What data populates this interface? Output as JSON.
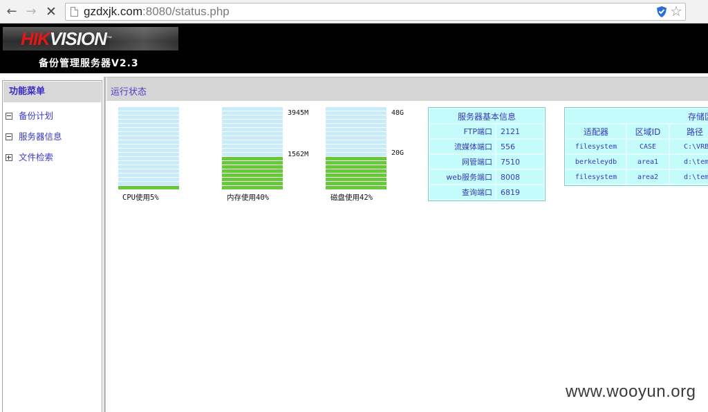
{
  "browser": {
    "url_host": "gzdxjk.com",
    "url_rest": ":8080/status.php",
    "back_icon": "←",
    "forward_icon": "→",
    "stop_icon": "✕",
    "star_icon": "☆"
  },
  "header": {
    "logo_hik": "HIK",
    "logo_vision": "VISION",
    "logo_tm": "™",
    "title": "备份管理服务器V2.3"
  },
  "sidebar": {
    "title": "功能菜单",
    "items": [
      {
        "label": "备份计划",
        "expanded": true
      },
      {
        "label": "服务器信息",
        "expanded": true
      },
      {
        "label": "文件检索",
        "expanded": false
      }
    ]
  },
  "main": {
    "title": "运行状态"
  },
  "gauges": [
    {
      "label": "CPU使用5%",
      "fraction": 0.05,
      "ticks": []
    },
    {
      "label": "内存使用40%",
      "fraction": 0.4,
      "ticks": [
        {
          "text": "3945M",
          "at": "top"
        },
        {
          "text": "1562M",
          "at": "fill"
        }
      ]
    },
    {
      "label": "磁盘使用42%",
      "fraction": 0.42,
      "ticks": [
        {
          "text": "48G",
          "at": "top"
        },
        {
          "text": "20G",
          "at": "fill"
        }
      ]
    }
  ],
  "server_info": {
    "title": "服务器基本信息",
    "rows": [
      {
        "key": "FTP端口",
        "value": "2121"
      },
      {
        "key": "流媒体端口",
        "value": "556"
      },
      {
        "key": "网管端口",
        "value": "7510"
      },
      {
        "key": "web服务端口",
        "value": "8008"
      },
      {
        "key": "查询端口",
        "value": "6819"
      }
    ]
  },
  "storage": {
    "title": "存储区",
    "headers": [
      "适配器",
      "区域ID",
      "路径"
    ],
    "rows": [
      [
        "filesystem",
        "CASE",
        "C:\\VRB"
      ],
      [
        "berkeleydb",
        "area1",
        "d:\\temp"
      ],
      [
        "filesystem",
        "area2",
        "d:\\temp"
      ]
    ]
  },
  "watermark": "www.wooyun.org",
  "colors": {
    "bar_empty": "#c8ecf9",
    "bar_fill": "#66c93a",
    "table_bg": "#c4fbfb",
    "link": "#3a3ac8"
  }
}
